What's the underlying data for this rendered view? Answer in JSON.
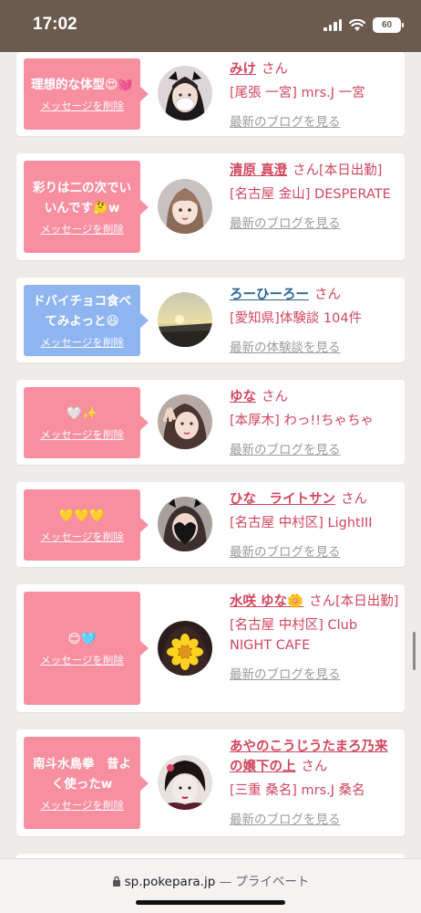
{
  "status": {
    "time": "17:02",
    "battery": "60"
  },
  "cards": [
    {
      "message": "理想的な体型😍💓",
      "delete_label": "メッセージを削除",
      "bubble": "pink",
      "name": "みけ",
      "name_color": "pink",
      "suffix": "さん",
      "shop": "[尾張 一宮] mrs.J 一宮",
      "latest": "最新のブログを見る",
      "avatar": "girl-mask"
    },
    {
      "message": "彩りは二の次でいいんです🤔w",
      "delete_label": "メッセージを削除",
      "bubble": "pink",
      "name": "清原 真澄",
      "name_color": "pink",
      "suffix": "さん[本日出勤]",
      "shop": "[名古屋 金山] DESPERATE",
      "latest": "最新のブログを見る",
      "avatar": "girl-short"
    },
    {
      "message": "ドバイチョコ食べてみよっと😆",
      "delete_label": "メッセージを削除",
      "bubble": "blue",
      "name": "ろーひーろー",
      "name_color": "blue",
      "suffix": "さん",
      "shop": "[愛知県]体験談 104件",
      "latest": "最新の体験談を見る",
      "avatar": "sunset"
    },
    {
      "message": "🤍✨",
      "delete_label": "メッセージを削除",
      "bubble": "pink",
      "name": "ゆな",
      "name_color": "pink",
      "suffix": "さん",
      "shop": "[本厚木] わっ!!ちゃちゃ",
      "latest": "最新のブログを見る",
      "avatar": "girl-peace"
    },
    {
      "message": "💛💛💛",
      "delete_label": "メッセージを削除",
      "bubble": "pink",
      "name": "ひな　ライトサン",
      "name_color": "pink",
      "suffix": "さん",
      "shop": "[名古屋 中村区] LightIII",
      "latest": "最新のブログを見る",
      "avatar": "girl-heart"
    },
    {
      "message": "😊🩵",
      "delete_label": "メッセージを削除",
      "bubble": "pink",
      "name": "水咲 ゆな🌼",
      "name_color": "pink",
      "suffix": "さん[本日出勤]",
      "shop": "[名古屋 中村区] Club NIGHT CAFE",
      "latest": "最新のブログを見る",
      "avatar": "flower"
    },
    {
      "message": "南斗水鳥拳　昔よく使ったw",
      "delete_label": "メッセージを削除",
      "bubble": "pink",
      "name": "あやのこうじうたまろ乃来の嬢下の上",
      "name_color": "pink",
      "suffix": "さん",
      "shop": "[三重 桑名] mrs.J 桑名",
      "latest": "最新のブログを見る",
      "avatar": "geisha"
    }
  ],
  "browser": {
    "domain": "sp.pokepara.jp",
    "private": "— プライベート"
  }
}
